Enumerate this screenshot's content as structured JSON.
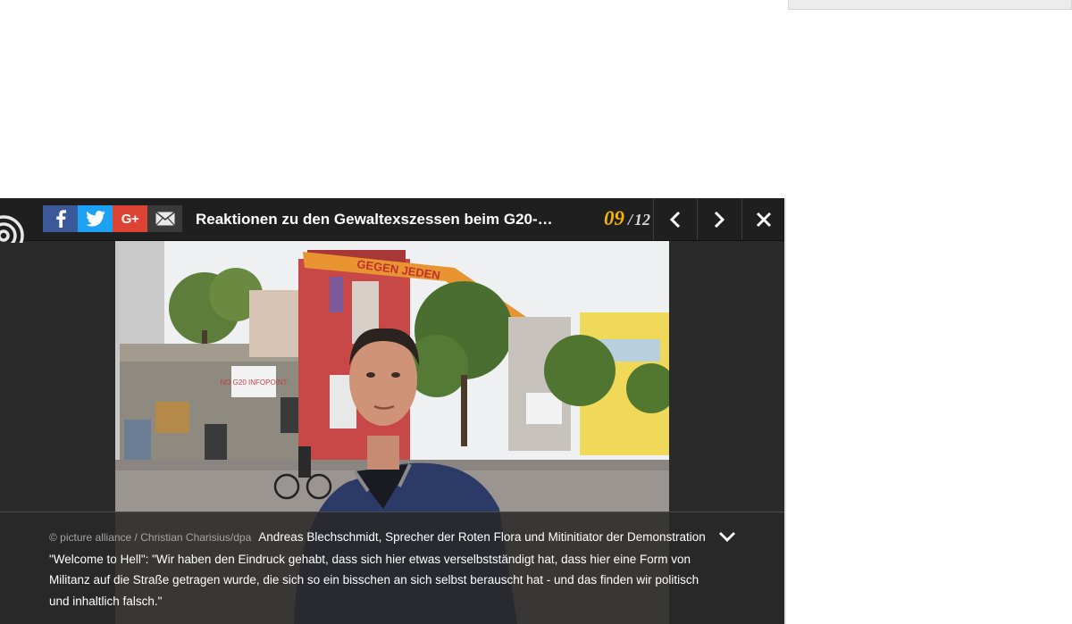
{
  "gallery": {
    "title": "Reaktionen zu den Gewaltexszessen beim G20-G...",
    "counter": {
      "current": "09",
      "separator": "/",
      "total": "12"
    },
    "share": {
      "facebook_icon": "facebook-icon",
      "twitter_icon": "twitter-icon",
      "googleplus_label": "G+",
      "email_icon": "mail-icon"
    },
    "nav": {
      "prev_icon": "chevron-left-icon",
      "next_icon": "chevron-right-icon",
      "close_icon": "close-icon"
    },
    "photo": {
      "banner_text": "GEGEN JEDEN",
      "poster_text": "NO G20 INFOPOINT"
    },
    "caption": {
      "credit": "© picture alliance / Christian Charisius/dpa",
      "text": "Andreas Blechschmidt, Sprecher der Roten Flora und Mitinitiator der Demonstration \"Welcome to Hell\": \"Wir haben den Eindruck gehabt, dass sich hier etwas verselbstständigt hat, dass hier eine Form von Militanz auf die Straße getragen wurde, die sich so ein bisschen an sich selbst berauscht hat - und das finden wir politisch und inhaltlich falsch.\"",
      "toggle_icon": "chevron-down-icon"
    }
  },
  "colors": {
    "accent_counter": "#f5b400",
    "facebook": "#3b5998",
    "twitter": "#1da1f2",
    "googleplus": "#dc4335"
  }
}
